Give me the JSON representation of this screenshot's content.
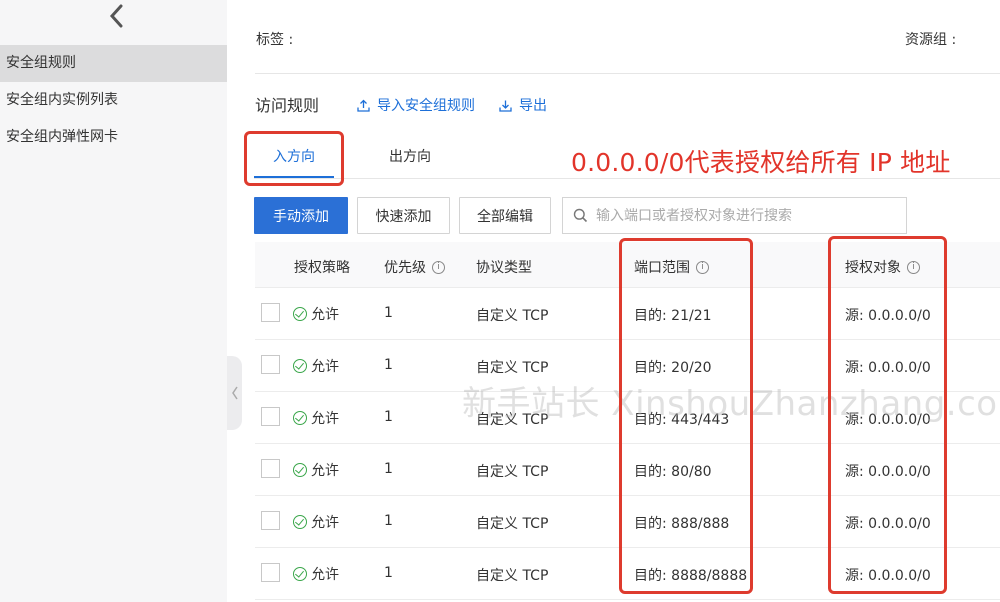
{
  "sidebar": {
    "items": [
      {
        "label": "安全组规则",
        "active": true
      },
      {
        "label": "安全组内实例列表",
        "active": false
      },
      {
        "label": "安全组内弹性网卡",
        "active": false
      }
    ]
  },
  "info": {
    "tag_label": "标签 :",
    "resource_group_label": "资源组 :"
  },
  "rules": {
    "title": "访问规则",
    "import_label": "导入安全组规则",
    "export_label": "导出"
  },
  "tabs": [
    {
      "label": "入方向",
      "active": true
    },
    {
      "label": "出方向",
      "active": false
    }
  ],
  "annotation": "0.0.0.0/0代表授权给所有 IP 地址",
  "toolbar": {
    "manual_add": "手动添加",
    "quick_add": "快速添加",
    "edit_all": "全部编辑",
    "search_placeholder": "输入端口或者授权对象进行搜索"
  },
  "table": {
    "columns": [
      "授权策略",
      "优先级",
      "协议类型",
      "端口范围",
      "授权对象"
    ],
    "rows": [
      {
        "policy": "允许",
        "priority": "1",
        "protocol": "自定义 TCP",
        "port": "目的: 21/21",
        "target": "源: 0.0.0.0/0"
      },
      {
        "policy": "允许",
        "priority": "1",
        "protocol": "自定义 TCP",
        "port": "目的: 20/20",
        "target": "源: 0.0.0.0/0"
      },
      {
        "policy": "允许",
        "priority": "1",
        "protocol": "自定义 TCP",
        "port": "目的: 443/443",
        "target": "源: 0.0.0.0/0"
      },
      {
        "policy": "允许",
        "priority": "1",
        "protocol": "自定义 TCP",
        "port": "目的: 80/80",
        "target": "源: 0.0.0.0/0"
      },
      {
        "policy": "允许",
        "priority": "1",
        "protocol": "自定义 TCP",
        "port": "目的: 888/888",
        "target": "源: 0.0.0.0/0"
      },
      {
        "policy": "允许",
        "priority": "1",
        "protocol": "自定义 TCP",
        "port": "目的: 8888/8888",
        "target": "源: 0.0.0.0/0"
      }
    ]
  },
  "watermark": "新手站长 XinshouZhanzhang.com",
  "colors": {
    "accent": "#2b70d6",
    "link": "#1d6fd8",
    "annotation_red": "#de3b2e",
    "allow_green": "#3aa64a",
    "sidebar_bg": "#f6f6f7"
  },
  "icons": [
    "chevron-left-icon",
    "upload-icon",
    "download-icon",
    "search-icon",
    "info-icon",
    "check-circle-icon"
  ]
}
